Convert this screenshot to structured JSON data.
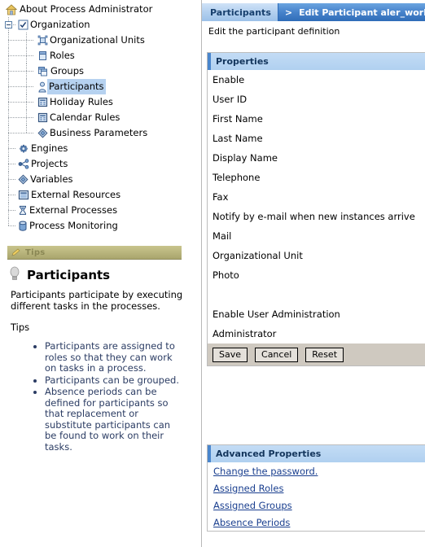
{
  "sidebar": {
    "tree": [
      {
        "label": "About Process Administrator",
        "icon": "home-icon",
        "depth": 0,
        "root": true,
        "selected": false
      },
      {
        "label": "Organization",
        "icon": "checkbox-icon",
        "depth": 0,
        "expander": "minus",
        "selected": false
      },
      {
        "label": "Organizational Units",
        "icon": "org-unit-icon",
        "depth": 1,
        "selected": false
      },
      {
        "label": "Roles",
        "icon": "role-icon",
        "depth": 1,
        "selected": false
      },
      {
        "label": "Groups",
        "icon": "group-icon",
        "depth": 1,
        "selected": false
      },
      {
        "label": "Participants",
        "icon": "participant-icon",
        "depth": 1,
        "selected": true
      },
      {
        "label": "Holiday Rules",
        "icon": "calendar-icon",
        "depth": 1,
        "selected": false
      },
      {
        "label": "Calendar Rules",
        "icon": "calendar-icon",
        "depth": 1,
        "selected": false
      },
      {
        "label": "Business Parameters",
        "icon": "diamond-icon",
        "depth": 1,
        "selected": false
      },
      {
        "label": "Engines",
        "icon": "gear-icon",
        "depth": 0,
        "selected": false
      },
      {
        "label": "Projects",
        "icon": "share-icon",
        "depth": 0,
        "selected": false
      },
      {
        "label": "Variables",
        "icon": "diamond-icon",
        "depth": 0,
        "selected": false
      },
      {
        "label": "External Resources",
        "icon": "table-icon",
        "depth": 0,
        "selected": false
      },
      {
        "label": "External Processes",
        "icon": "hourglass-icon",
        "depth": 0,
        "selected": false
      },
      {
        "label": "Process Monitoring",
        "icon": "database-icon",
        "depth": 0,
        "selected": false
      }
    ],
    "tips": {
      "bar_title": "Tips",
      "bar_icon": "pencil-icon",
      "heading_icon": "lightbulb-icon",
      "heading": "Participants",
      "paragraph": "Participants participate by executing different tasks in the processes.",
      "sub_heading": "Tips",
      "bullets": [
        "Participants are assigned to roles so that they can work on tasks in a process.",
        "Participants can be grouped.",
        "Absence periods can be defined for participants so that replacement or substitute participants can be found to work on their tasks."
      ]
    }
  },
  "main": {
    "breadcrumb": {
      "parent": "Participants",
      "separator": ">",
      "current": "Edit Participant aler_workfl"
    },
    "subtitle": "Edit the participant definition",
    "properties": {
      "header": "Properties",
      "fields": [
        {
          "label": "Enable"
        },
        {
          "label": "User ID"
        },
        {
          "label": "First Name"
        },
        {
          "label": "Last Name"
        },
        {
          "label": "Display Name"
        },
        {
          "label": "Telephone"
        },
        {
          "label": "Fax"
        },
        {
          "label": "Notify by e-mail when new instances arrive"
        },
        {
          "label": "Mail"
        },
        {
          "label": "Organizational Unit"
        },
        {
          "label": "Photo"
        },
        {
          "label": ""
        },
        {
          "label": "Enable User Administration"
        },
        {
          "label": "Administrator"
        }
      ],
      "buttons": [
        {
          "label": "Save",
          "name": "save-button"
        },
        {
          "label": "Cancel",
          "name": "cancel-button"
        },
        {
          "label": "Reset",
          "name": "reset-button"
        }
      ]
    },
    "advanced": {
      "header": "Advanced Properties",
      "links": [
        {
          "label": "Change the password."
        },
        {
          "label": "Assigned Roles"
        },
        {
          "label": "Assigned Groups"
        },
        {
          "label": "Absence Periods"
        }
      ]
    }
  },
  "colors": {
    "crumb_bar": "#4a86cd",
    "panel_header": "#b0d0f0",
    "tips_bar": "#b8b47c",
    "link": "#1a3f8f",
    "selection": "#b6d2f0",
    "button_bar": "#cfc9c0"
  }
}
